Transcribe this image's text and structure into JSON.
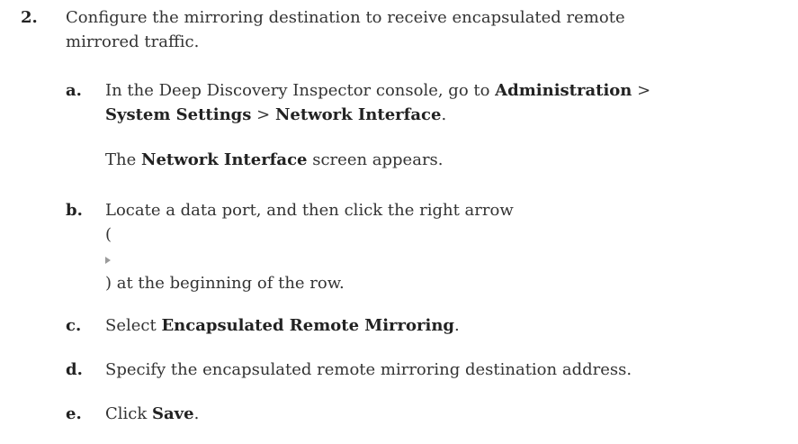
{
  "step": {
    "number": "2.",
    "text_line1": "Configure the mirroring destination to receive encapsulated remote",
    "text_line2": "mirrored traffic."
  },
  "substeps": {
    "a": {
      "letter": "a.",
      "line1_prefix": "In the Deep Discovery Inspector console, go to ",
      "admin": "Administration",
      "sep1": " >",
      "system_settings": "System Settings",
      "sep2": " > ",
      "network_interface": "Network Interface",
      "period": ".",
      "note_prefix": "The ",
      "note_bold": "Network Interface",
      "note_suffix": " screen appears."
    },
    "b": {
      "letter": "b.",
      "line1": "Locate a data port, and then click the right arrow",
      "open_paren": "(",
      "icon": "right-arrow-icon",
      "line3": ") at the beginning of the row."
    },
    "c": {
      "letter": "c.",
      "prefix": "Select ",
      "bold": "Encapsulated Remote Mirroring",
      "suffix": "."
    },
    "d": {
      "letter": "d.",
      "text": "Specify the encapsulated remote mirroring destination address."
    },
    "e": {
      "letter": "e.",
      "prefix": "Click ",
      "bold": "Save",
      "suffix": "."
    }
  }
}
